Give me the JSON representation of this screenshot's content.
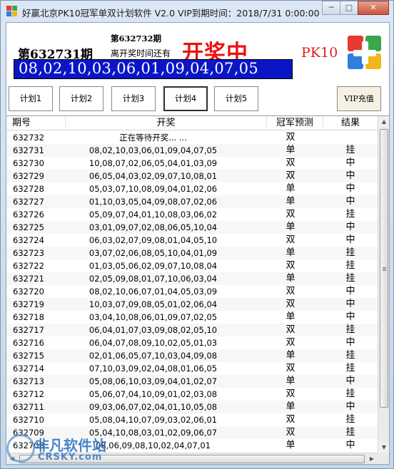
{
  "window": {
    "title": "好赢北京PK10冠军单双计划软件 V2.0 VIP到期时间：2018/7/31 0:00:00",
    "minimize": "─",
    "maximize": "□",
    "close": "✕"
  },
  "header": {
    "current_period": "第632731期",
    "next_period": "第632732期",
    "countdown_label": "离开奖时间还有",
    "status": "开奖中",
    "game_label": "PK10",
    "draw_numbers": "08,02,10,03,06,01,09,04,07,05"
  },
  "plans": [
    "计划1",
    "计划2",
    "计划3",
    "计划4",
    "计划5"
  ],
  "active_plan": 3,
  "vip_button": "VIP充值",
  "colors": {
    "result_bg": "#0a16c6",
    "status_red": "#ee1111",
    "logo_red": "#e63a2e",
    "logo_green": "#3aa84a",
    "logo_blue": "#2f7fe0",
    "logo_yellow": "#f3b51b"
  },
  "table": {
    "headers": [
      "期号",
      "开奖",
      "冠军预测",
      "结果"
    ],
    "rows": [
      [
        "632732",
        "正在等待开奖... ...",
        "双",
        ""
      ],
      [
        "632731",
        "08,02,10,03,06,01,09,04,07,05",
        "单",
        "挂"
      ],
      [
        "632730",
        "10,08,07,02,06,05,04,01,03,09",
        "双",
        "中"
      ],
      [
        "632729",
        "06,05,04,03,02,09,07,10,08,01",
        "双",
        "中"
      ],
      [
        "632728",
        "05,03,07,10,08,09,04,01,02,06",
        "单",
        "中"
      ],
      [
        "632727",
        "01,10,03,05,04,09,08,07,02,06",
        "单",
        "中"
      ],
      [
        "632726",
        "05,09,07,04,01,10,08,03,06,02",
        "双",
        "挂"
      ],
      [
        "632725",
        "03,01,09,07,02,08,06,05,10,04",
        "单",
        "中"
      ],
      [
        "632724",
        "06,03,02,07,09,08,01,04,05,10",
        "双",
        "中"
      ],
      [
        "632723",
        "03,07,02,06,08,05,10,04,01,09",
        "单",
        "挂"
      ],
      [
        "632722",
        "01,03,05,06,02,09,07,10,08,04",
        "双",
        "挂"
      ],
      [
        "632721",
        "02,05,09,08,01,07,10,06,03,04",
        "单",
        "挂"
      ],
      [
        "632720",
        "08,02,10,06,07,01,04,05,03,09",
        "双",
        "中"
      ],
      [
        "632719",
        "10,03,07,09,08,05,01,02,06,04",
        "双",
        "中"
      ],
      [
        "632718",
        "03,04,10,08,06,01,09,07,02,05",
        "单",
        "中"
      ],
      [
        "632717",
        "06,04,01,07,03,09,08,02,05,10",
        "双",
        "挂"
      ],
      [
        "632716",
        "06,04,07,08,09,10,02,05,01,03",
        "双",
        "中"
      ],
      [
        "632715",
        "02,01,06,05,07,10,03,04,09,08",
        "单",
        "挂"
      ],
      [
        "632714",
        "07,10,03,09,02,04,08,01,06,05",
        "双",
        "挂"
      ],
      [
        "632713",
        "05,08,06,10,03,09,04,01,02,07",
        "单",
        "中"
      ],
      [
        "632712",
        "05,06,07,04,10,09,01,02,03,08",
        "双",
        "挂"
      ],
      [
        "632711",
        "09,03,06,07,02,04,01,10,05,08",
        "单",
        "中"
      ],
      [
        "632710",
        "05,08,04,10,07,09,03,02,06,01",
        "双",
        "挂"
      ],
      [
        "632709",
        "05,04,10,08,03,01,02,09,06,07",
        "双",
        "挂"
      ],
      [
        "632708",
        "08,06,09,08,10,02,04,07,01",
        "单",
        "中"
      ]
    ]
  },
  "watermark": {
    "title": "非凡软件站",
    "subtitle": "CRSKY.com"
  }
}
